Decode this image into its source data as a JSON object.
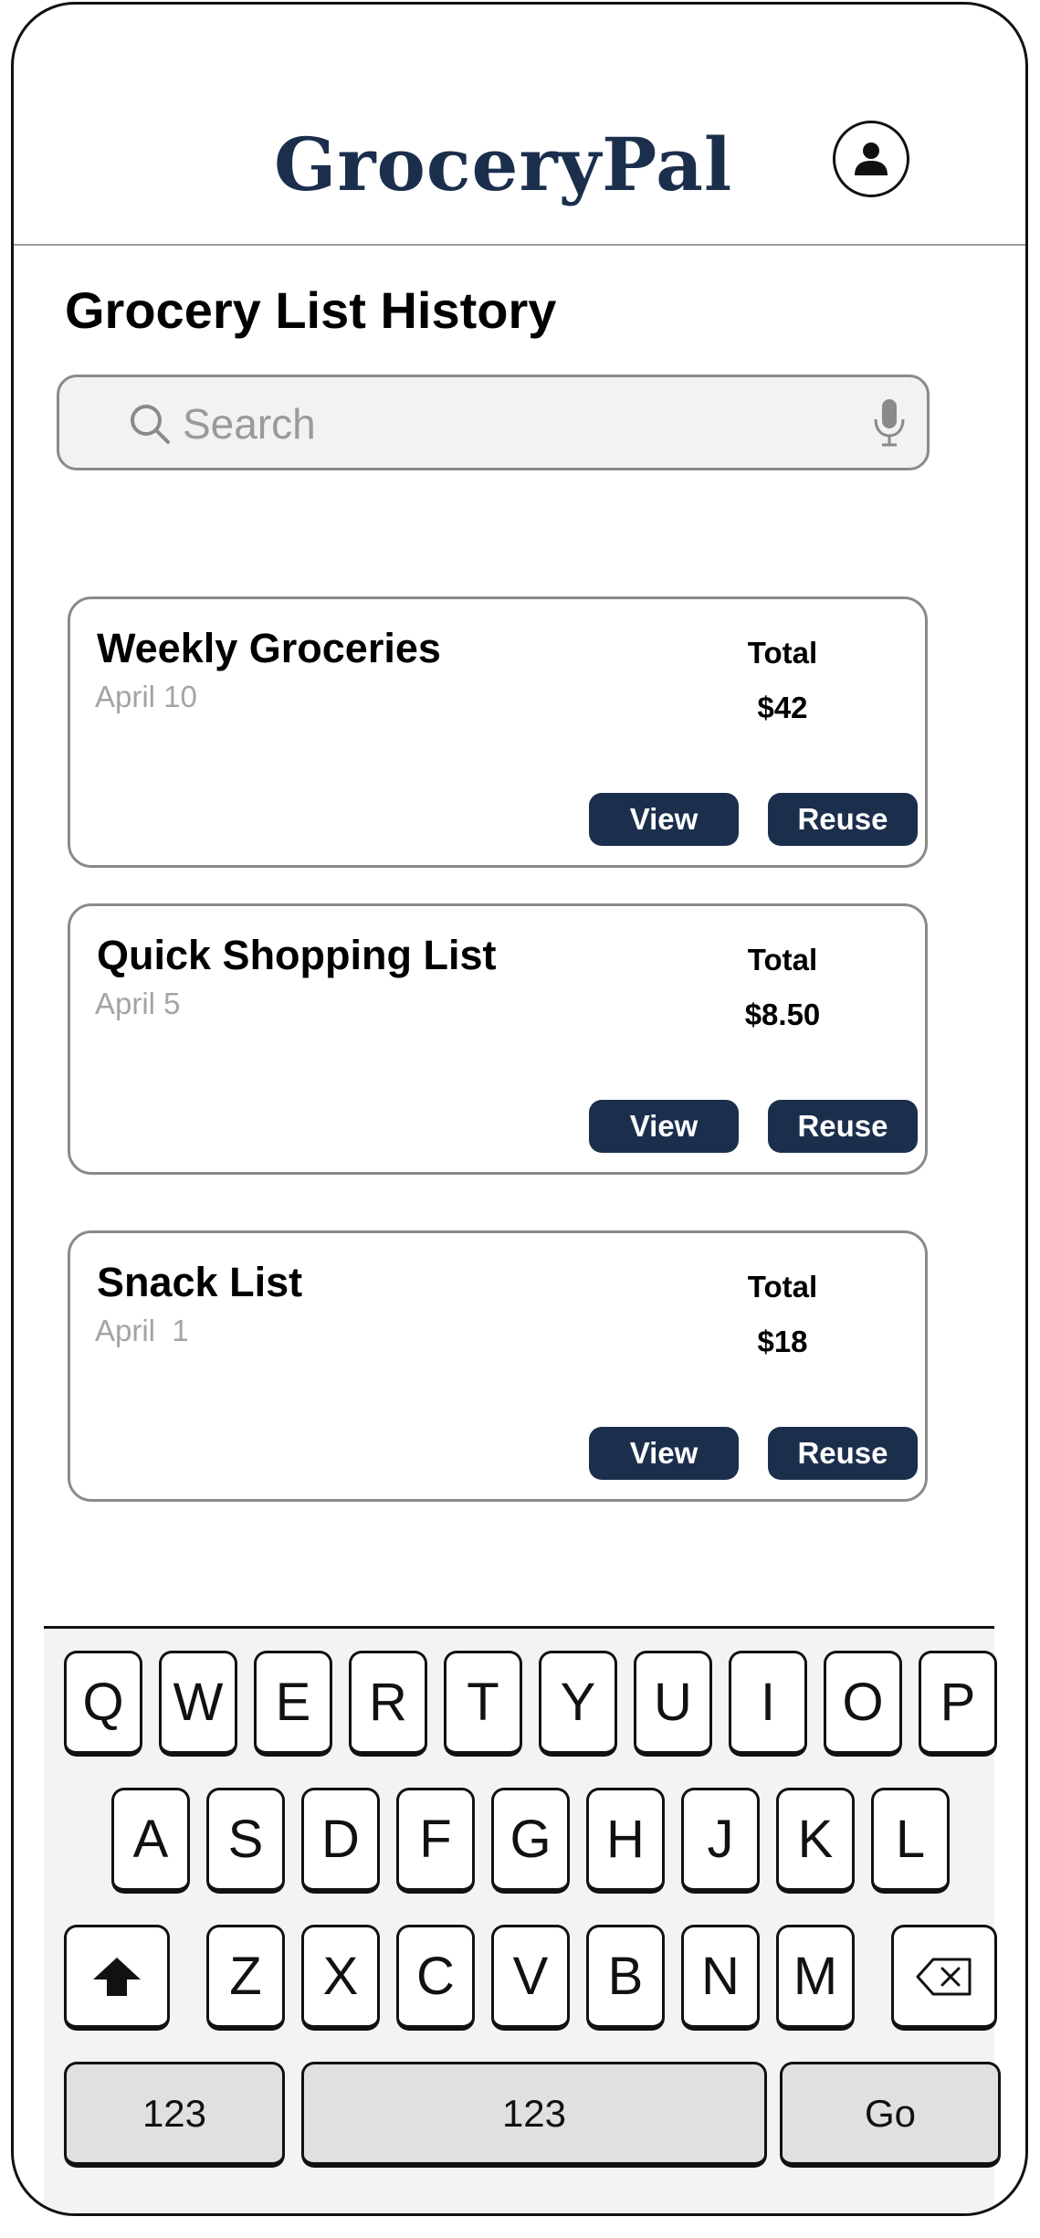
{
  "app": {
    "title": "GroceryPal"
  },
  "page": {
    "title": "Grocery List History"
  },
  "search": {
    "placeholder": "Search",
    "value": ""
  },
  "icons": {
    "profile": "user-profile-icon",
    "search": "search-icon",
    "mic": "microphone-icon",
    "shift": "shift-arrow-icon",
    "backspace": "backspace-icon"
  },
  "colors": {
    "brand": "#1b2f4d",
    "muted_text": "#a4a4a4",
    "border": "#8a8a8a"
  },
  "lists": [
    {
      "title": "Weekly Groceries",
      "date": "April 10",
      "total_label": "Total",
      "total": "$42",
      "view_label": "View",
      "reuse_label": "Reuse"
    },
    {
      "title": "Quick Shopping List",
      "date": "April 5",
      "total_label": "Total",
      "total": "$8.50",
      "view_label": "View",
      "reuse_label": "Reuse"
    },
    {
      "title": "Snack List",
      "date": "April  1",
      "total_label": "Total",
      "total": "$18",
      "view_label": "View",
      "reuse_label": "Reuse"
    }
  ],
  "keyboard": {
    "row1": [
      "Q",
      "W",
      "E",
      "R",
      "T",
      "Y",
      "U",
      "I",
      "O",
      "P"
    ],
    "row2": [
      "A",
      "S",
      "D",
      "F",
      "G",
      "H",
      "J",
      "K",
      "L"
    ],
    "row3": [
      "Z",
      "X",
      "C",
      "V",
      "B",
      "N",
      "M"
    ],
    "numbers_label": "123",
    "space_label": "123",
    "go_label": "Go"
  }
}
